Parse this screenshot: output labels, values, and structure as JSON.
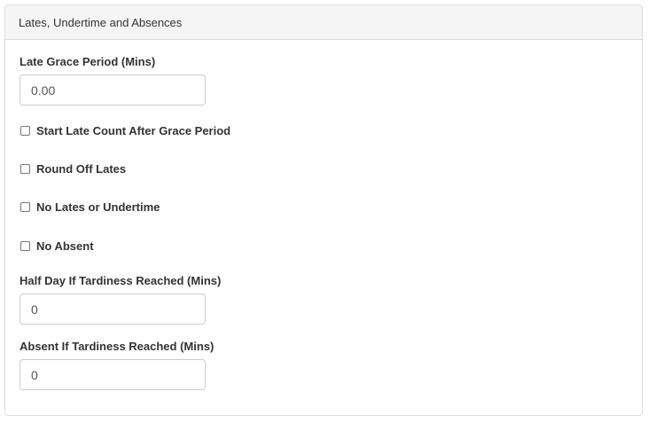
{
  "panel": {
    "title": "Lates, Undertime and Absences"
  },
  "late_grace_period": {
    "label": "Late Grace Period (Mins)",
    "value": "0.00"
  },
  "checkboxes": [
    {
      "label": "Start Late Count After Grace Period",
      "checked": false
    },
    {
      "label": "Round Off Lates",
      "checked": false
    },
    {
      "label": "No Lates or Undertime",
      "checked": false
    },
    {
      "label": "No Absent",
      "checked": false
    }
  ],
  "half_day_tardiness": {
    "label": "Half Day If Tardiness Reached (Mins)",
    "value": "0"
  },
  "absent_tardiness": {
    "label": "Absent If Tardiness Reached (Mins)",
    "value": "0"
  }
}
